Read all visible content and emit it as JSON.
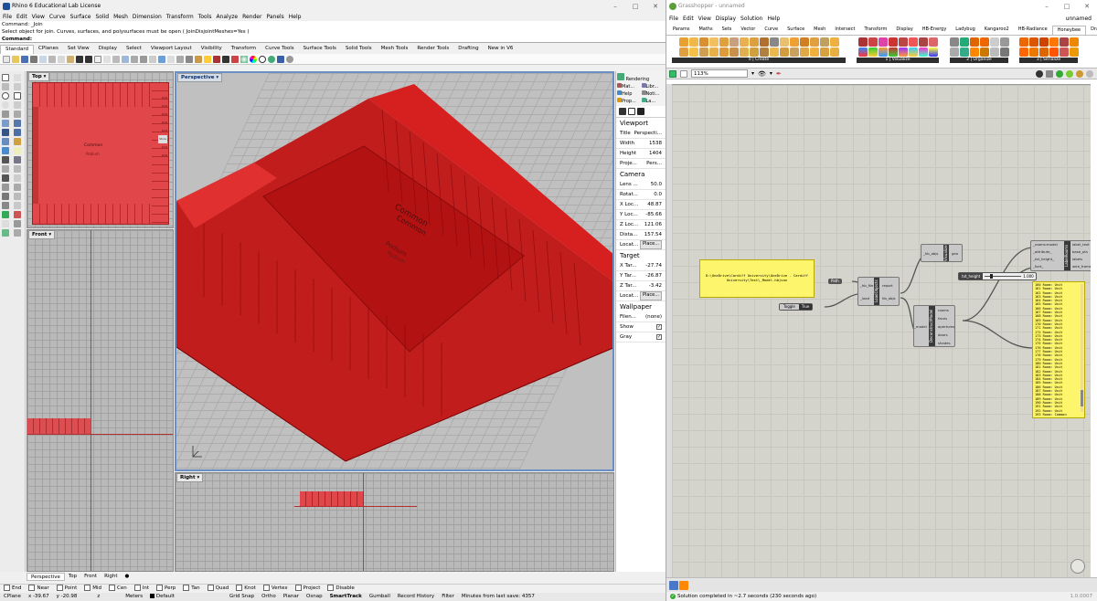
{
  "rhino": {
    "title": "Rhino 6 Educational Lab License",
    "menu": [
      "File",
      "Edit",
      "View",
      "Curve",
      "Surface",
      "Solid",
      "Mesh",
      "Dimension",
      "Transform",
      "Tools",
      "Analyze",
      "Render",
      "Panels",
      "Help"
    ],
    "command_history": [
      "Command: _Join",
      "Select object for join.  Curves, surfaces, and polysurfaces must be open ( JoinDisjointMeshes=Yes )"
    ],
    "command_prompt": "Command:",
    "toolbar_tabs": [
      "Standard",
      "CPlanes",
      "Set View",
      "Display",
      "Select",
      "Viewport Layout",
      "Visibility",
      "Transform",
      "Curve Tools",
      "Surface Tools",
      "Solid Tools",
      "Mesh Tools",
      "Render Tools",
      "Drafting",
      "New in V6"
    ],
    "viewports": {
      "top": "Top",
      "perspective": "Perspective",
      "front": "Front",
      "right": "Right"
    },
    "top_labels": [
      "Common",
      "Podium"
    ],
    "top_room_tags": [
      "Store",
      "Unit",
      "Unit",
      "Unit",
      "Unit",
      "Unit",
      "Unit",
      "Unit"
    ],
    "persp_labels": [
      "Common",
      "Common",
      "Podium",
      "Podium"
    ],
    "viewport_tabs": [
      "Perspective",
      "Top",
      "Front",
      "Right"
    ],
    "panel_tabs": [
      {
        "icon": "rendering-icon",
        "label": "Rendering"
      },
      {
        "icon": "materials-icon",
        "label": "Mat..."
      },
      {
        "icon": "libraries-icon",
        "label": "Libr..."
      },
      {
        "icon": "help-icon",
        "label": "Help"
      },
      {
        "icon": "notes-icon",
        "label": "Noti..."
      },
      {
        "icon": "properties-icon",
        "label": "Prop..."
      },
      {
        "icon": "layers-icon",
        "label": "La..."
      }
    ],
    "properties": {
      "viewport_title": "Viewport",
      "viewport_rows": [
        [
          "Title",
          "Perspecti..."
        ],
        [
          "Width",
          "1538"
        ],
        [
          "Height",
          "1404"
        ],
        [
          "Proje...",
          "Pers..."
        ]
      ],
      "camera_title": "Camera",
      "camera_rows": [
        [
          "Lens ...",
          "50.0"
        ],
        [
          "Rotat...",
          "0.0"
        ],
        [
          "X Loc...",
          "48.87"
        ],
        [
          "Y Loc...",
          "-85.66"
        ],
        [
          "Z Loc...",
          "121.06"
        ],
        [
          "Dista...",
          "157.54"
        ]
      ],
      "camera_place": "Locat...",
      "place_btn": "Place...",
      "target_title": "Target",
      "target_rows": [
        [
          "X Tar...",
          "-27.74"
        ],
        [
          "Y Tar...",
          "-26.87"
        ],
        [
          "Z Tar...",
          "-3.42"
        ]
      ],
      "target_place": "Locat...",
      "wallpaper_title": "Wallpaper",
      "wallpaper_file": [
        "Filen...",
        "(none)"
      ],
      "wallpaper_show": "Show",
      "wallpaper_gray": "Gray"
    },
    "osnaps": [
      "End",
      "Near",
      "Point",
      "Mid",
      "Cen",
      "Int",
      "Perp",
      "Tan",
      "Quad",
      "Knot",
      "Vertex",
      "Project",
      "Disable"
    ],
    "status": {
      "cplane": "CPlane",
      "x": "x -39.67",
      "y": "y -20.98",
      "z": "z",
      "units": "Meters",
      "layer": "Default",
      "items": [
        "Grid Snap",
        "Ortho",
        "Planar",
        "Osnap",
        "SmartTrack",
        "Gumball",
        "Record History",
        "Filter",
        "Minutes from last save: 4357"
      ]
    }
  },
  "grasshopper": {
    "title": "Grasshopper - unnamed",
    "doc_name": "unnamed",
    "menu": [
      "File",
      "Edit",
      "View",
      "Display",
      "Solution",
      "Help"
    ],
    "tabs": [
      "Params",
      "Maths",
      "Sets",
      "Vector",
      "Curve",
      "Surface",
      "Mesh",
      "Intersect",
      "Transform",
      "Display",
      "HB-Energy",
      "Ladybug",
      "Kangaroo2",
      "HB-Radiance",
      "Honeybee",
      "Dragonfly"
    ],
    "active_tab": "Honeybee",
    "ribbon_groups": [
      "0 | Create",
      "1 | Visualize",
      "2 | Organize",
      "3 | Serialize"
    ],
    "zoom": "113%",
    "components": {
      "path_panel": "D:\\OneDrive\\Cardiff University\\OneDrive - Cardiff University\\Test\\_Model.hbjson",
      "path_label": "Path",
      "toggle_label": "Toggle",
      "toggle_value": "True",
      "load_name": "LoadObjects",
      "load_inputs": [
        "_hb_file",
        "_load"
      ],
      "load_outputs": [
        "report",
        "hb_objs"
      ],
      "vis_name": "Visualize",
      "vis_inputs": [
        "_hb_objs"
      ],
      "vis_outputs": [
        "geo"
      ],
      "decon_name": "DeconstructModel",
      "decon_inputs": [
        "_model"
      ],
      "decon_outputs": [
        "rooms",
        "faces",
        "apertures",
        "doors",
        "shades"
      ],
      "label_name": "LabelRooms",
      "label_inputs": [
        "_rooms:model",
        "_attribute_",
        "_txt_height_",
        "_font_"
      ],
      "label_outputs": [
        "label_text",
        "base_pts",
        "labels",
        "wire_frame"
      ],
      "slider_label": "txt_height",
      "slider_value": "1.000"
    },
    "room_list": [
      "160 Room: Unit",
      "161 Room: Unit",
      "162 Room: Unit",
      "163 Room: Unit",
      "164 Room: Unit",
      "165 Room: Unit",
      "166 Room: Unit",
      "167 Room: Unit",
      "168 Room: Unit",
      "169 Room: Unit",
      "170 Room: Unit",
      "171 Room: Unit",
      "172 Room: Unit",
      "173 Room: Unit",
      "174 Room: Unit",
      "175 Room: Unit",
      "176 Room: Unit",
      "177 Room: Unit",
      "178 Room: Unit",
      "179 Room: Unit",
      "180 Room: Unit",
      "181 Room: Unit",
      "182 Room: Unit",
      "183 Room: Unit",
      "184 Room: Unit",
      "185 Room: Unit",
      "186 Room: Unit",
      "187 Room: Unit",
      "188 Room: Unit",
      "189 Room: Unit",
      "190 Room: Unit",
      "191 Room: Unit",
      "192 Room: Unit",
      "193 Room: Common"
    ],
    "status": "Solution completed in ~2.7 seconds (230 seconds ago)",
    "version": "1.0.0007"
  }
}
